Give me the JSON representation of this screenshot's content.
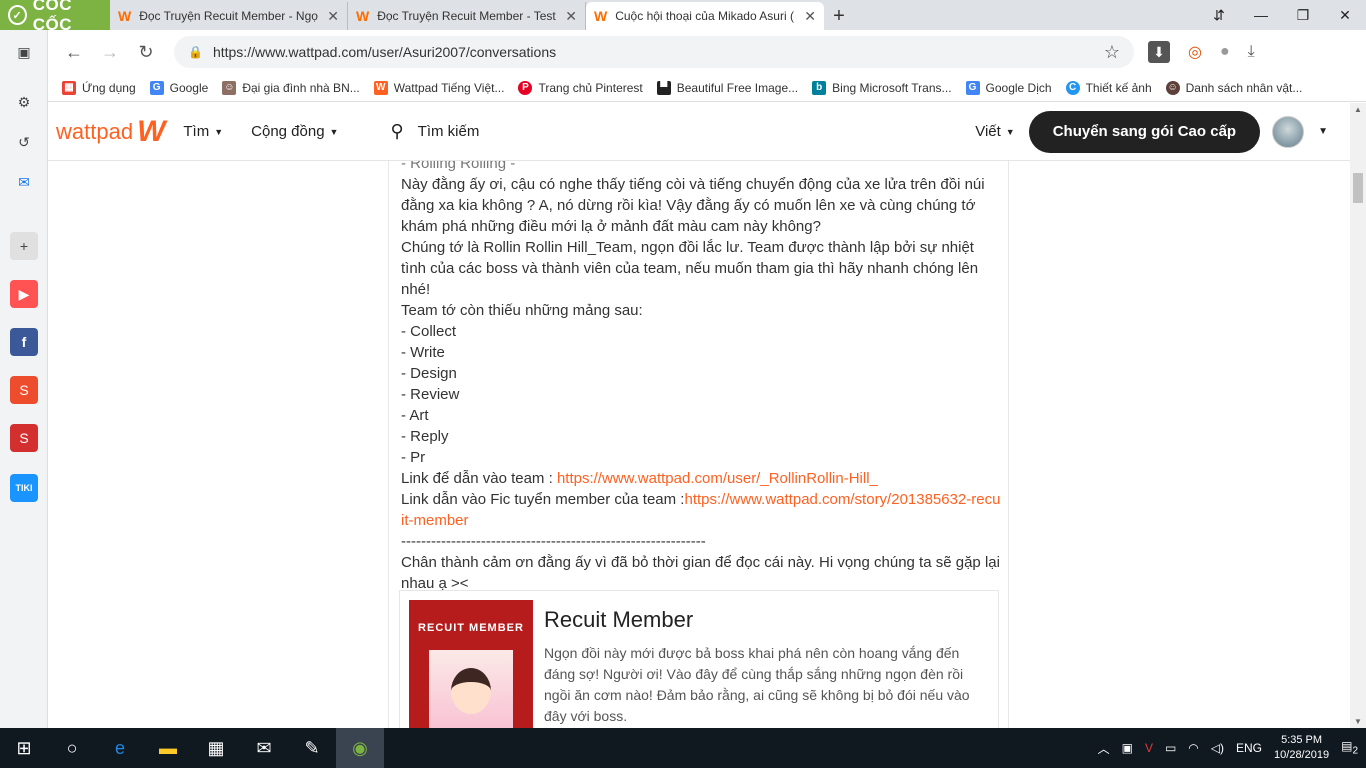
{
  "browser": {
    "brand": "CỐC CỐC",
    "tabs": [
      {
        "title": "Đọc Truyện Recuit Member - Ngọ",
        "active": false
      },
      {
        "title": "Đọc Truyện Recuit Member - Test",
        "active": false
      },
      {
        "title": "Cuộc hội thoại của Mikado Asuri (",
        "active": true
      }
    ],
    "url": "https://www.wattpad.com/user/Asuri2007/conversations",
    "bookmarks": [
      "Ứng dụng",
      "Google",
      "Đại gia đình nhà BN...",
      "Wattpad Tiếng Việt...",
      "Trang chủ Pinterest",
      "Beautiful Free Image...",
      "Bing Microsoft Trans...",
      "Google Dịch",
      "Thiết kế ảnh",
      "Danh sách nhân vật..."
    ]
  },
  "header": {
    "logo": "wattpad",
    "menu_discover": "Tìm",
    "menu_community": "Cộng đồng",
    "search_placeholder": "Tìm kiếm",
    "write": "Viết",
    "premium": "Chuyển sang gói Cao cấp"
  },
  "message": {
    "partial_top": "- Rolling Rolling -",
    "intro": "Này đằng ấy ơi, cậu có nghe thấy tiếng còi và tiếng chuyển động của xe lửa trên đồi núi đằng xa kia không ? A, nó dừng rồi kìa! Vậy đằng ấy có muốn lên xe và cùng chúng tớ khám phá những điều mới lạ ở mảnh đất màu cam này không?",
    "team_info": "Chúng tớ là Rollin Rollin Hill_Team, ngọn đồi lắc lư. Team được thành lập bởi sự nhiệt tình của các boss và thành viên của team, nếu muốn tham gia thì hãy nhanh chóng lên nhé!",
    "missing_intro": "Team tớ còn thiếu những mảng sau:",
    "roles": [
      "- Collect",
      "- Write",
      "- Design",
      "- Review",
      "- Art",
      "- Reply",
      "- Pr"
    ],
    "team_link_label": "Link để dẫn vào team : ",
    "team_link": "https://www.wattpad.com/user/_RollinRollin-Hill_",
    "fic_link_label": "Link dẫn vào Fic tuyển member của team :",
    "fic_link": "https://www.wattpad.com/story/201385632-recuit-member",
    "divider": "-------------------------------------------------------------",
    "thanks": "Chân thành cảm ơn đằng ấy vì đã bỏ thời gian để đọc cái này. Hi vọng chúng ta sẽ gặp lại nhau ạ ><"
  },
  "embed": {
    "cover_text": "RECUIT MEMBER",
    "title": "Recuit Member",
    "description": "Ngọn đồi này mới được bả boss khai phá nên còn hoang vắng đến đáng sợ! Người ơi! Vào đây để cùng thắp sắng những ngọn đèn rồi ngồi ăn cơm nào! Đảm bảo rằng, ai cũng sẽ không bị bỏ đói nếu vào đây với boss."
  },
  "taskbar": {
    "language": "ENG",
    "time": "5:35 PM",
    "date": "10/28/2019",
    "notifications": "2"
  },
  "colors": {
    "accent": "#ff6122",
    "browser_brand": "#7cb342",
    "taskbar": "#101820"
  }
}
